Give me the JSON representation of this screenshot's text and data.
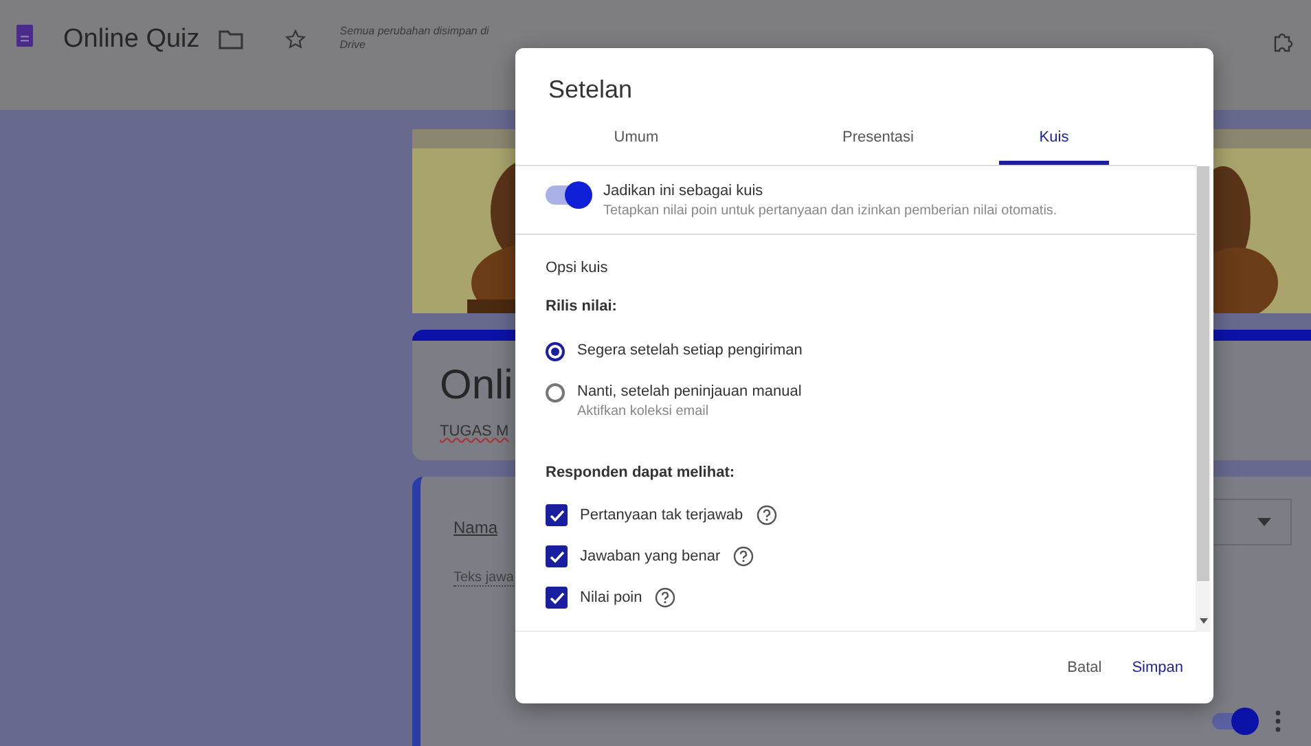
{
  "app": {
    "title": "Online Quiz",
    "save_status": "Semua perubahan disimpan di Drive"
  },
  "form": {
    "title": "Onli",
    "description": "TUGAS M",
    "question": {
      "title": "Nama",
      "answer_placeholder": "Teks jawa",
      "required_on": true
    }
  },
  "dialog": {
    "title": "Setelan",
    "tabs": [
      {
        "label": "Umum",
        "selected": false
      },
      {
        "label": "Presentasi",
        "selected": false
      },
      {
        "label": "Kuis",
        "selected": true
      }
    ],
    "quiz_toggle": {
      "label": "Jadikan ini sebagai kuis",
      "description": "Tetapkan nilai poin untuk pertanyaan dan izinkan pemberian nilai otomatis.",
      "on": true
    },
    "section_title": "Opsi kuis",
    "release": {
      "heading": "Rilis nilai:",
      "options": [
        {
          "label": "Segera setelah setiap pengiriman",
          "selected": true
        },
        {
          "label": "Nanti, setelah peninjauan manual",
          "hint": "Aktifkan koleksi email",
          "selected": false
        }
      ]
    },
    "visibility": {
      "heading": "Responden dapat melihat:",
      "options": [
        {
          "label": "Pertanyaan tak terjawab",
          "checked": true
        },
        {
          "label": "Jawaban yang benar",
          "checked": true
        },
        {
          "label": "Nilai poin",
          "checked": true
        }
      ]
    },
    "buttons": [
      {
        "label": "Batal",
        "kind": "secondary"
      },
      {
        "label": "Simpan",
        "kind": "primary"
      }
    ]
  }
}
